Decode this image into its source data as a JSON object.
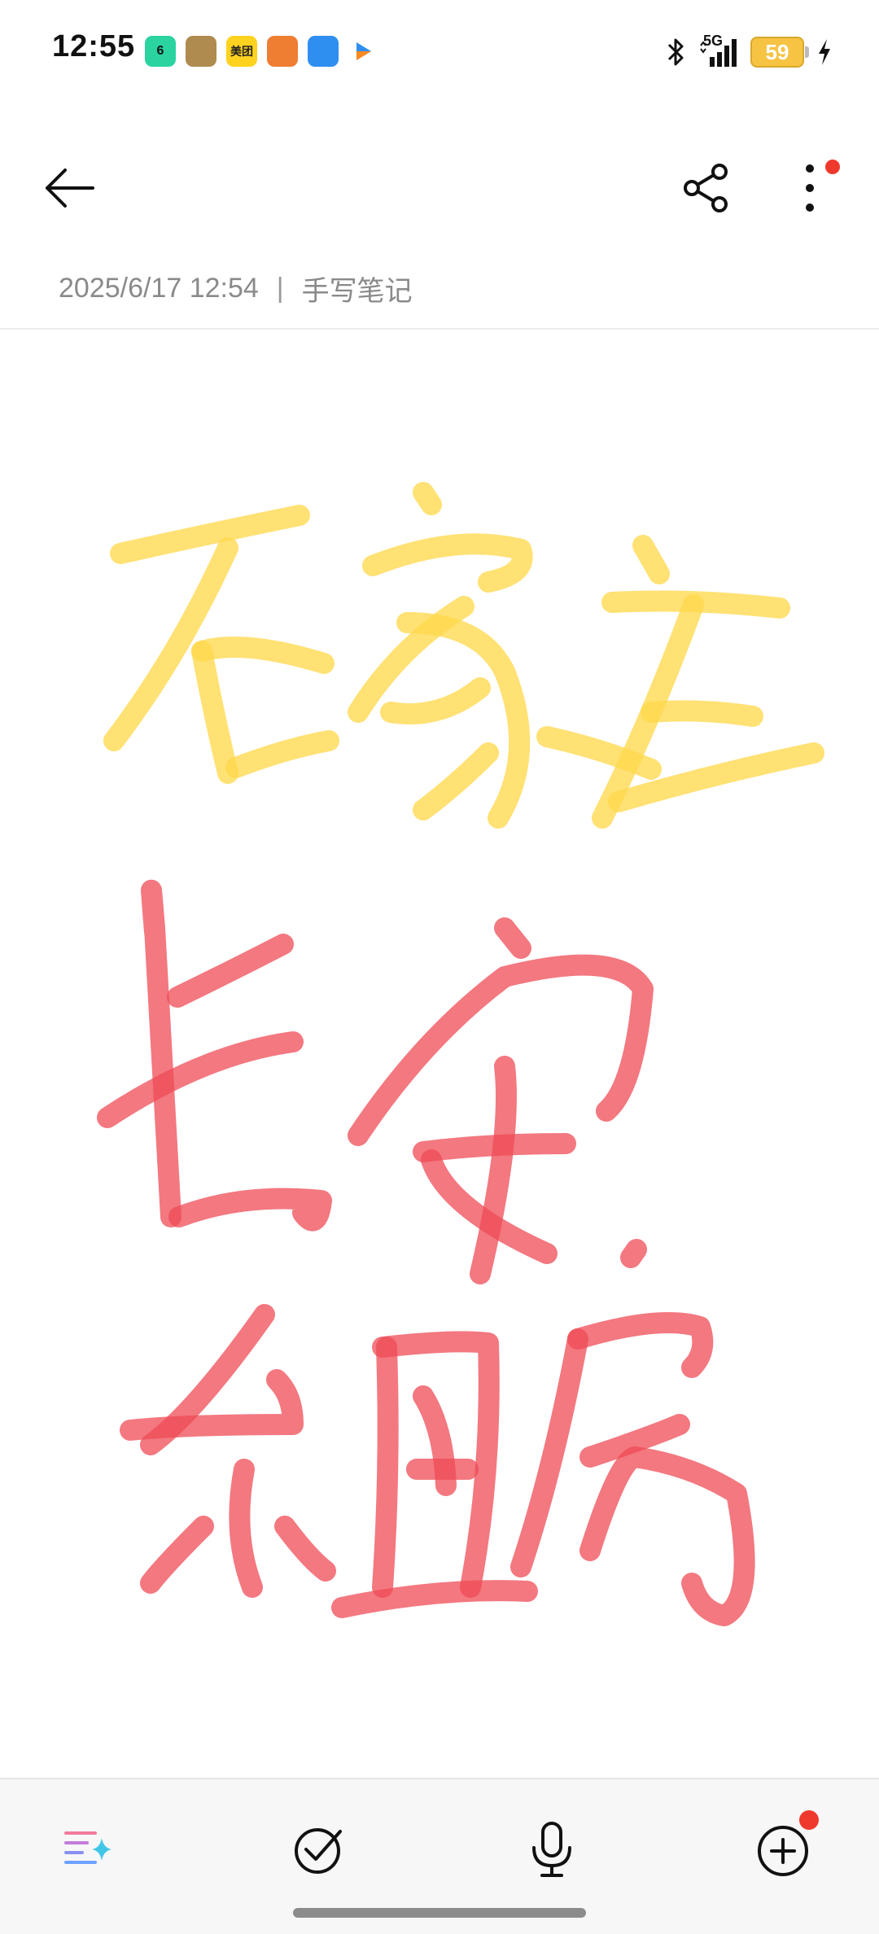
{
  "status_bar": {
    "time": "12:55",
    "apps": [
      {
        "name": "video-app-icon",
        "text": "6",
        "color": "#2bd3a1"
      },
      {
        "name": "game-app-icon",
        "text": "",
        "color": "#b08b4f"
      },
      {
        "name": "meituan-app-icon",
        "text": "美团",
        "color": "#ffd21f"
      },
      {
        "name": "food-app-icon",
        "text": "",
        "color": "#ef7d32"
      },
      {
        "name": "reader-app-icon",
        "text": "",
        "color": "#2f8ff0"
      },
      {
        "name": "arrow-app-icon",
        "text": "",
        "color": "#ffffff"
      }
    ],
    "network": "5G",
    "battery": "59"
  },
  "toolbar": {
    "back_icon": "arrow-left-icon",
    "share_icon": "share-icon",
    "more_icon": "more-vertical-icon"
  },
  "meta": {
    "date": "2025/6/17 12:54",
    "separator": "|",
    "category": "手写笔记"
  },
  "colors": {
    "yellow_ink": "#ffd84d",
    "red_ink": "#ef4b55",
    "accent_red": "#f0392d"
  },
  "bottom_bar": {
    "items": [
      {
        "name": "ai-format-icon"
      },
      {
        "name": "checklist-icon"
      },
      {
        "name": "microphone-icon"
      },
      {
        "name": "add-icon"
      }
    ]
  }
}
